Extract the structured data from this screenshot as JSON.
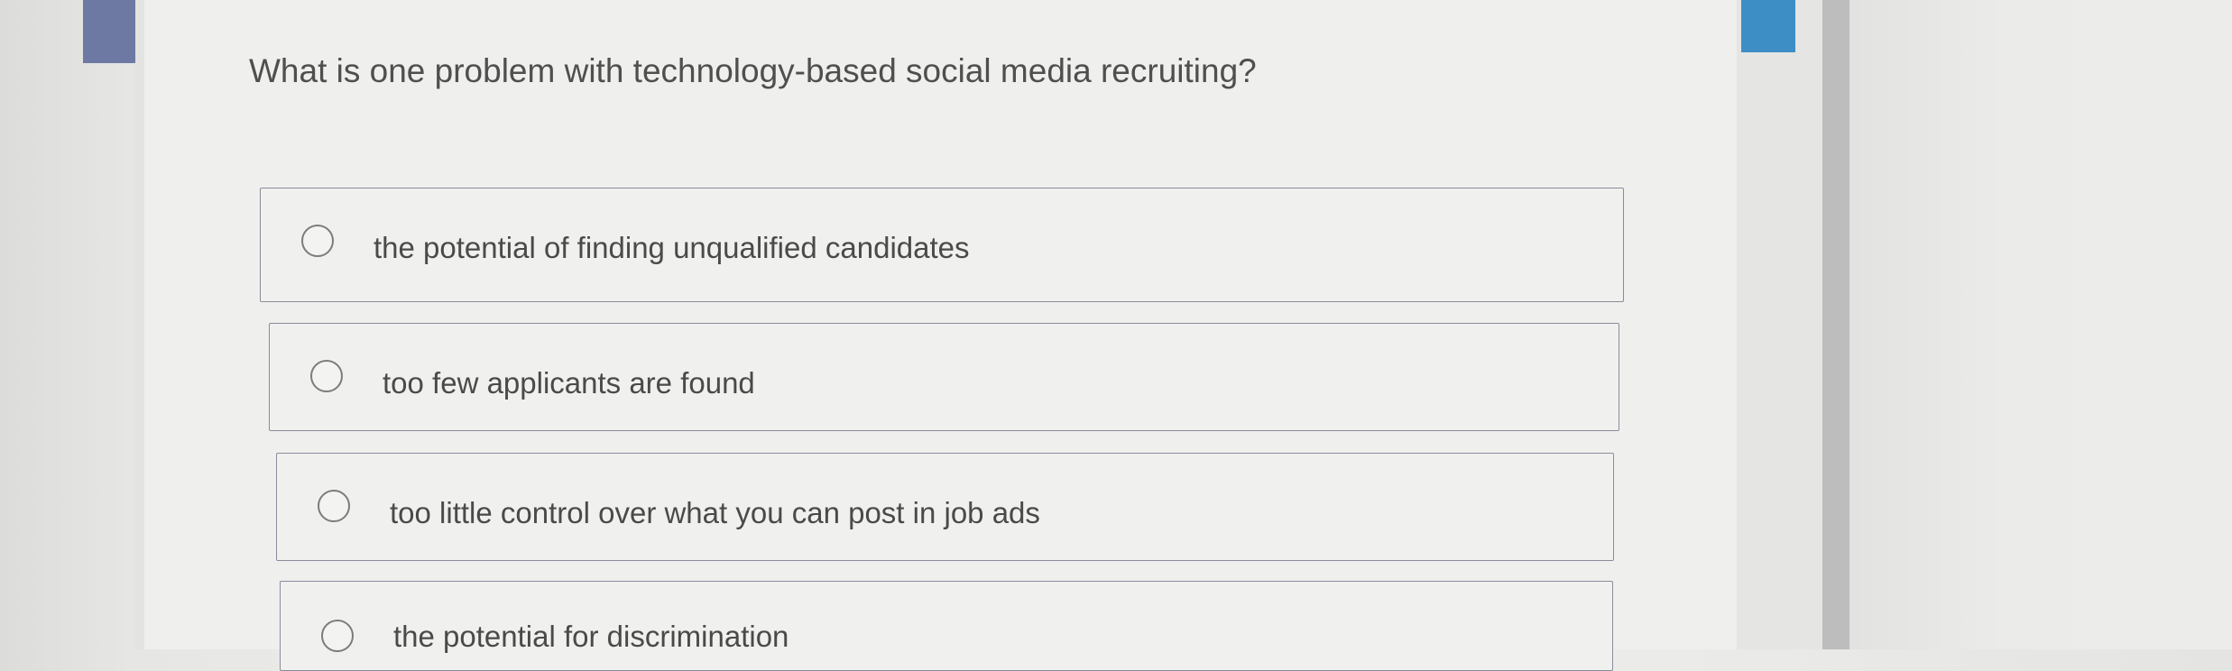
{
  "question": {
    "text": "What is one problem with technology-based social media recruiting?"
  },
  "options": [
    {
      "label": "the potential of finding unqualified candidates",
      "selected": false
    },
    {
      "label": "too few applicants are found",
      "selected": false
    },
    {
      "label": "too little control over what you can post in job ads",
      "selected": false
    },
    {
      "label": "the potential for discrimination",
      "selected": false
    }
  ],
  "colors": {
    "left_accent": "#6d79a3",
    "right_accent": "#3d8ec4",
    "option_border": "#8a8c9c",
    "text": "#4f4f4f"
  }
}
